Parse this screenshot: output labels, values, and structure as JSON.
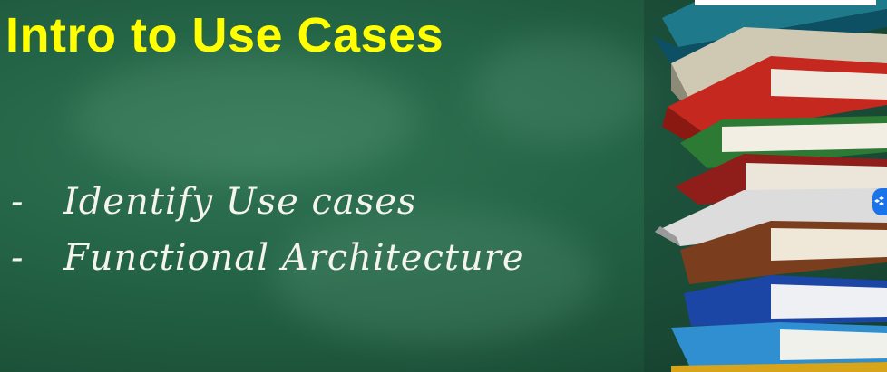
{
  "slide": {
    "title": "Intro to Use Cases",
    "bullets": [
      {
        "marker": "-",
        "text": "Identify Use cases"
      },
      {
        "marker": "-",
        "text": "Functional Architecture"
      }
    ]
  },
  "colors": {
    "chalkboard": "#246446",
    "title": "#ffff00",
    "chalk_text": "#f4f4ec"
  },
  "icons": {
    "books": "book-stack-icon",
    "edge_widget": "floating-widget-icon"
  }
}
